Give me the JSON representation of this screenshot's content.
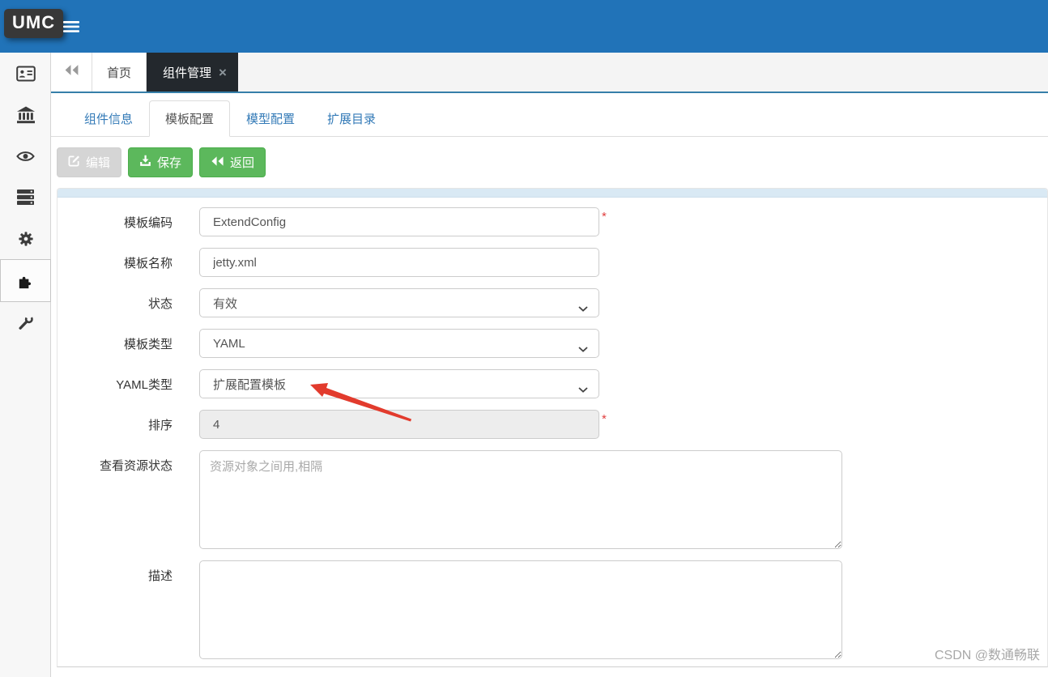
{
  "header": {
    "logo_text": "UMC"
  },
  "sidebar": {
    "items": [
      {
        "icon": "address-card-icon"
      },
      {
        "icon": "bank-icon"
      },
      {
        "icon": "eye-icon"
      },
      {
        "icon": "server-icon"
      },
      {
        "icon": "gear-icon"
      },
      {
        "icon": "puzzle-icon",
        "selected": true
      },
      {
        "icon": "wrench-icon"
      }
    ]
  },
  "tabbar": {
    "home_tab": "首页",
    "active_tab": "组件管理",
    "close_glyph": "×"
  },
  "subtabs": {
    "items": [
      {
        "label": "组件信息"
      },
      {
        "label": "模板配置",
        "active": true
      },
      {
        "label": "模型配置"
      },
      {
        "label": "扩展目录"
      }
    ]
  },
  "toolbar": {
    "edit": "编辑",
    "save": "保存",
    "back": "返回"
  },
  "form": {
    "required_marker": "*",
    "fields": [
      {
        "label": "模板编码",
        "type": "text",
        "value": "ExtendConfig",
        "required": true
      },
      {
        "label": "模板名称",
        "type": "text",
        "value": "jetty.xml"
      },
      {
        "label": "状态",
        "type": "select",
        "value": "有效"
      },
      {
        "label": "模板类型",
        "type": "select",
        "value": "YAML"
      },
      {
        "label": "YAML类型",
        "type": "select",
        "value": "扩展配置模板"
      },
      {
        "label": "排序",
        "type": "text",
        "value": "4",
        "required": true,
        "disabled": true
      },
      {
        "label": "查看资源状态",
        "type": "textarea",
        "value": "",
        "placeholder": "资源对象之间用,相隔"
      },
      {
        "label": "描述",
        "type": "textarea",
        "value": "",
        "placeholder": ""
      }
    ]
  },
  "watermark": "CSDN @数通畅联",
  "colors": {
    "header_blue": "#2173b8",
    "active_tab_dark": "#23282d",
    "tab_underline": "#367fa9",
    "button_green": "#5cb85c",
    "panel_strip": "#d9e9f4",
    "link_blue": "#337ab7",
    "required_red": "#e03e3e",
    "arrow_red": "#e23b2d"
  }
}
